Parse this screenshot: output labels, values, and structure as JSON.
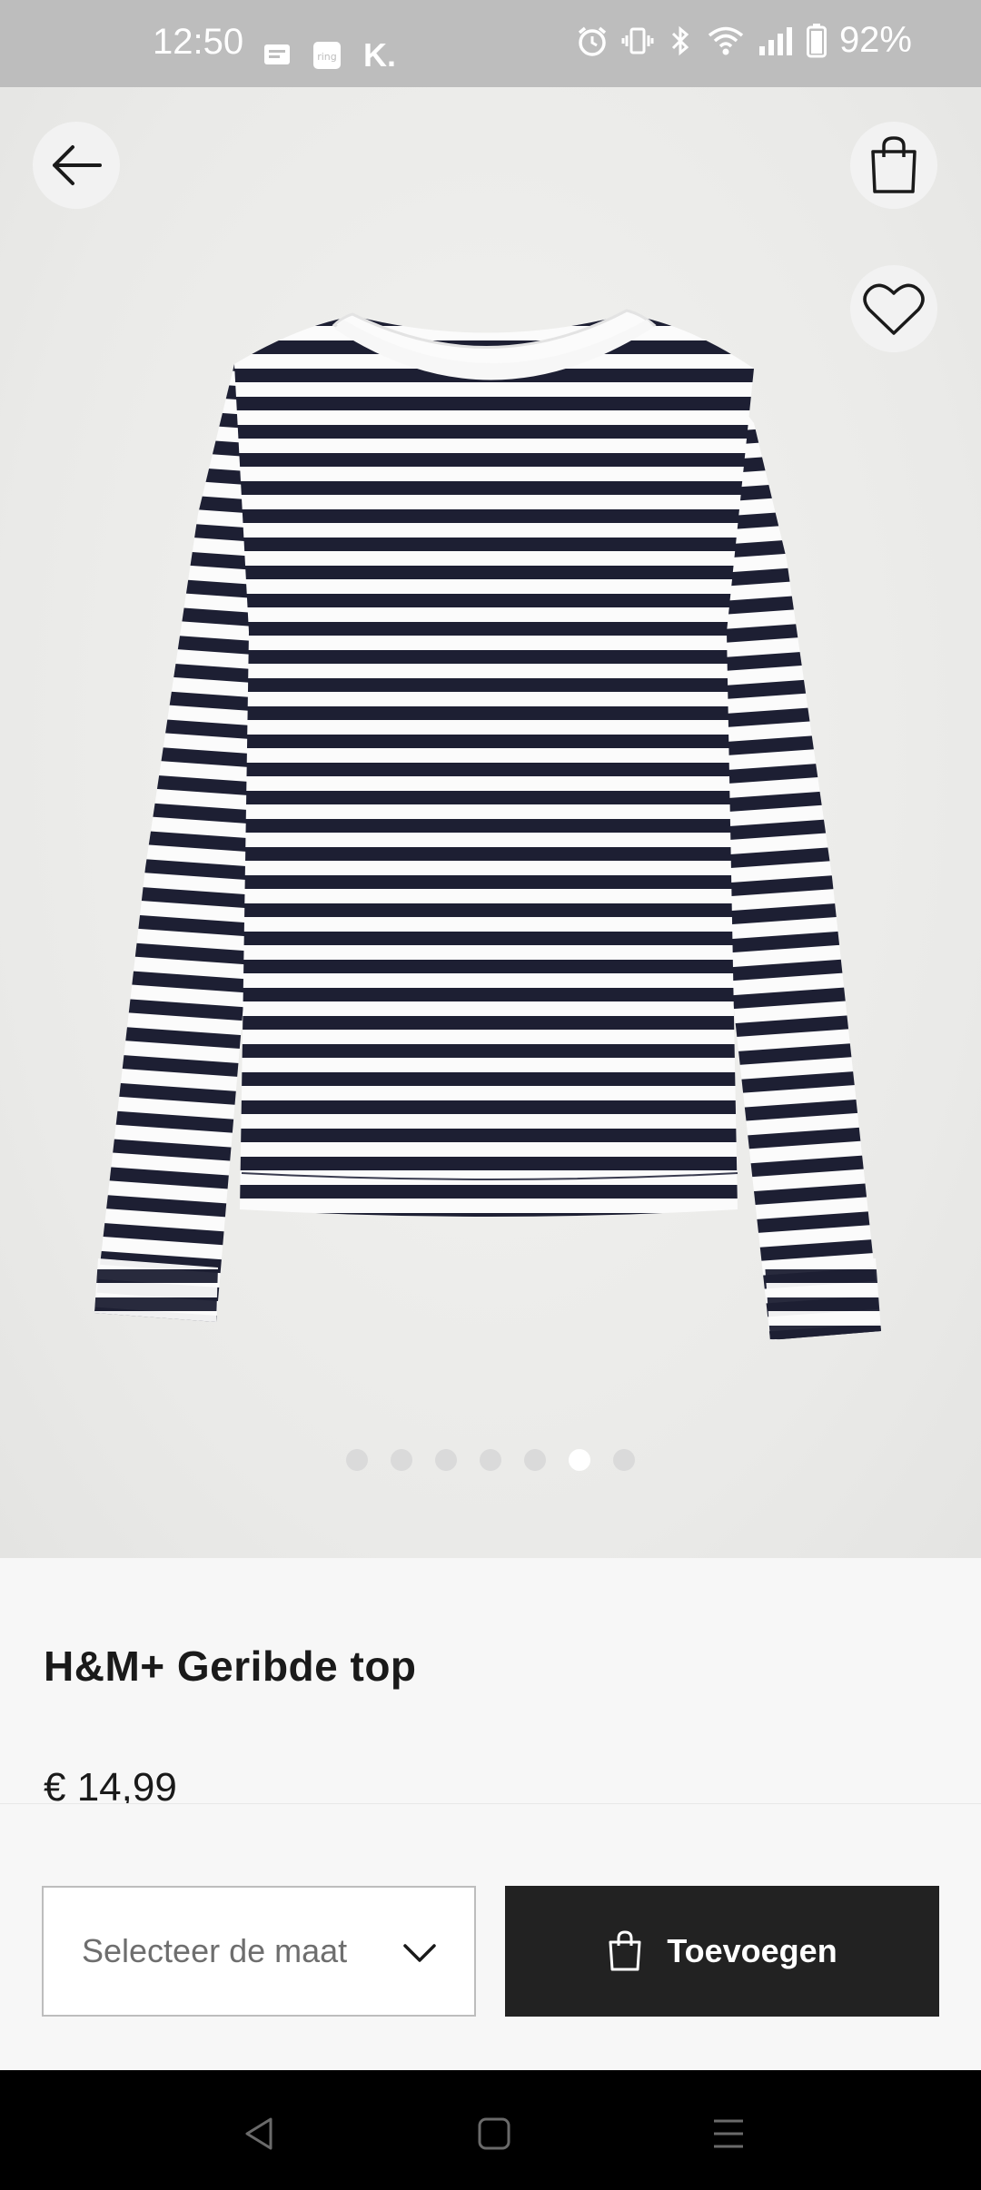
{
  "status_bar": {
    "time": "12:50",
    "battery": "92%",
    "left_icons": [
      "message-icon",
      "ring-icon",
      "k-icon"
    ],
    "right_icons": [
      "alarm-icon",
      "vibrate-icon",
      "bluetooth-icon",
      "wifi-icon",
      "signal-icon",
      "battery-icon"
    ],
    "k_label": "K.",
    "ring_label": "ring"
  },
  "header": {
    "back_icon": "arrow-left-icon",
    "bag_icon": "shopping-bag-icon",
    "favorite_icon": "heart-icon"
  },
  "gallery": {
    "image_count": 7,
    "active_index": 5,
    "image_subject": "striped long-sleeve top"
  },
  "product": {
    "title": "H&M+ Geribde top",
    "price": "€ 14,99"
  },
  "actions": {
    "size_placeholder": "Selecteer de maat",
    "add_label": "Toevoegen"
  },
  "nav": {
    "items": [
      "back-nav-icon",
      "home-nav-icon",
      "recents-nav-icon"
    ]
  },
  "colors": {
    "stripe_dark": "#1d1f33",
    "button_dark": "#222222",
    "status_bar": "#bdbdbd"
  }
}
